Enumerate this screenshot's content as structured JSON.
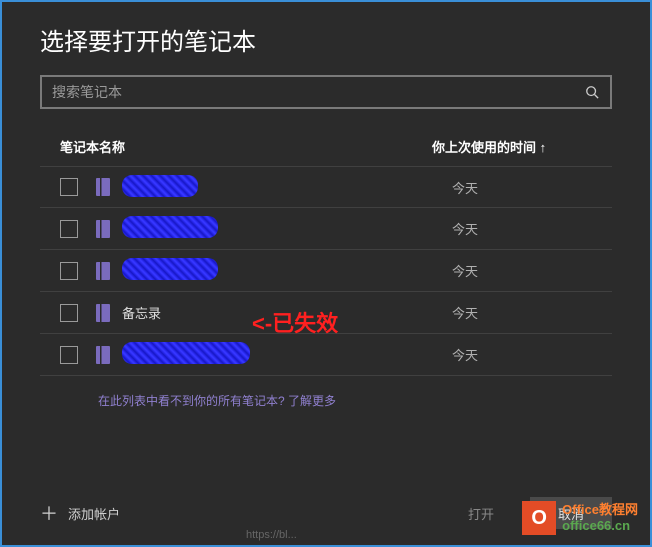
{
  "title": "选择要打开的笔记本",
  "search": {
    "placeholder": "搜索笔记本"
  },
  "headers": {
    "name": "笔记本名称",
    "time": "你上次使用的时间 ↑"
  },
  "rows": [
    {
      "name": "████",
      "scribble_width": 76,
      "time": "今天"
    },
    {
      "name": "█████",
      "scribble_width": 96,
      "time": "今天"
    },
    {
      "name": "█████",
      "scribble_width": 96,
      "time": "今天"
    },
    {
      "name": "备忘录",
      "scribble_width": 0,
      "time": "今天"
    },
    {
      "name": "██████",
      "scribble_width": 128,
      "time": "今天"
    }
  ],
  "annotation": "<-已失效",
  "help": {
    "text": "在此列表中看不到你的所有笔记本? ",
    "link": "了解更多"
  },
  "addAccount": "添加帐户",
  "buttons": {
    "open": "打开",
    "cancel": "取消"
  },
  "watermark": {
    "line1": "Office教程网",
    "line2": "office66.cn",
    "logoLetter": "O"
  },
  "urlHint": "https://bl..."
}
